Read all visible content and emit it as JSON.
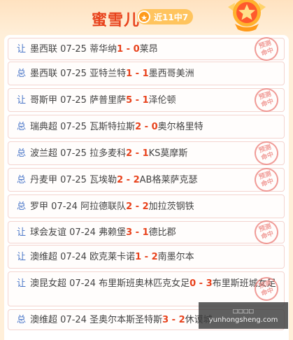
{
  "header": {
    "title": "蜜雪儿",
    "badge_icon": "star-icon",
    "badge_text": "近11中7",
    "medal_icon": "star-medal-icon"
  },
  "colors": {
    "accent": "#e8421c",
    "tag": "#4a76c8",
    "stamp": "#ee8b86",
    "background": "#ffefd9"
  },
  "rows": [
    {
      "tag": "让",
      "league": "墨西联",
      "date": "07-25",
      "home": "蒂华纳",
      "home_score": "1",
      "sep": " - ",
      "away_score": "0",
      "away": "莱昂",
      "stamp": [
        "预测",
        "命中"
      ]
    },
    {
      "tag": "总",
      "league": "墨西联",
      "date": "07-25",
      "home": "亚特兰特",
      "home_score": "1",
      "sep": " - ",
      "away_score": "1",
      "away": "墨西哥美洲",
      "stamp": null
    },
    {
      "tag": "让",
      "league": "哥斯甲",
      "date": "07-25",
      "home": "萨普里萨",
      "home_score": "5",
      "sep": " - ",
      "away_score": "1",
      "away": "泽伦顿",
      "stamp": [
        "预测",
        "命中"
      ]
    },
    {
      "tag": "总",
      "league": "瑞典超",
      "date": "07-25",
      "home": "瓦斯特拉斯",
      "home_score": "2",
      "sep": " - ",
      "away_score": "0",
      "away": "奥尔格里特",
      "stamp": null
    },
    {
      "tag": "总",
      "league": "波兰超",
      "date": "07-25",
      "home": "拉多麦科",
      "home_score": "2",
      "sep": " - ",
      "away_score": "1",
      "away": "KS莫摩斯",
      "stamp": [
        "预测",
        "命中"
      ]
    },
    {
      "tag": "总",
      "league": "丹麦甲",
      "date": "07-25",
      "home": "瓦埃勒",
      "home_score": "2",
      "sep": " - ",
      "away_score": "2",
      "away": "AB格莱萨克瑟",
      "stamp": [
        "预测",
        "命中"
      ]
    },
    {
      "tag": "总",
      "league": "罗甲",
      "date": "07-24",
      "home": "阿拉德联队",
      "home_score": "2",
      "sep": " - ",
      "away_score": "2",
      "away": "加拉茨钢铁",
      "stamp": null
    },
    {
      "tag": "让",
      "league": "球会友谊",
      "date": "07-24",
      "home": "弗赖堡",
      "home_score": "3",
      "sep": " - ",
      "away_score": "1",
      "away": "德比郡",
      "stamp": [
        "预测",
        "命中"
      ]
    },
    {
      "tag": "让",
      "league": "澳维超",
      "date": "07-24",
      "home": "欧克莱卡诺",
      "home_score": "1",
      "sep": " - ",
      "away_score": "2",
      "away": "南墨尔本",
      "stamp": null
    },
    {
      "tag": "让",
      "league": "澳昆女超",
      "date": "07-24",
      "home": "布里斯班奥林匹克女足",
      "home_score": "0",
      "sep": " - ",
      "away_score": "3",
      "away": "布里斯班城女足",
      "stamp": [
        "预测",
        "命中"
      ]
    },
    {
      "tag": "总",
      "league": "澳维超",
      "date": "07-24",
      "home": "圣奥尔本斯圣特斯",
      "home_score": "3",
      "sep": " - ",
      "away_score": "2",
      "away": "休谟城",
      "stamp": null
    }
  ],
  "watermark": {
    "line1": "□□□□",
    "line2": "yunhongsheng.com"
  }
}
